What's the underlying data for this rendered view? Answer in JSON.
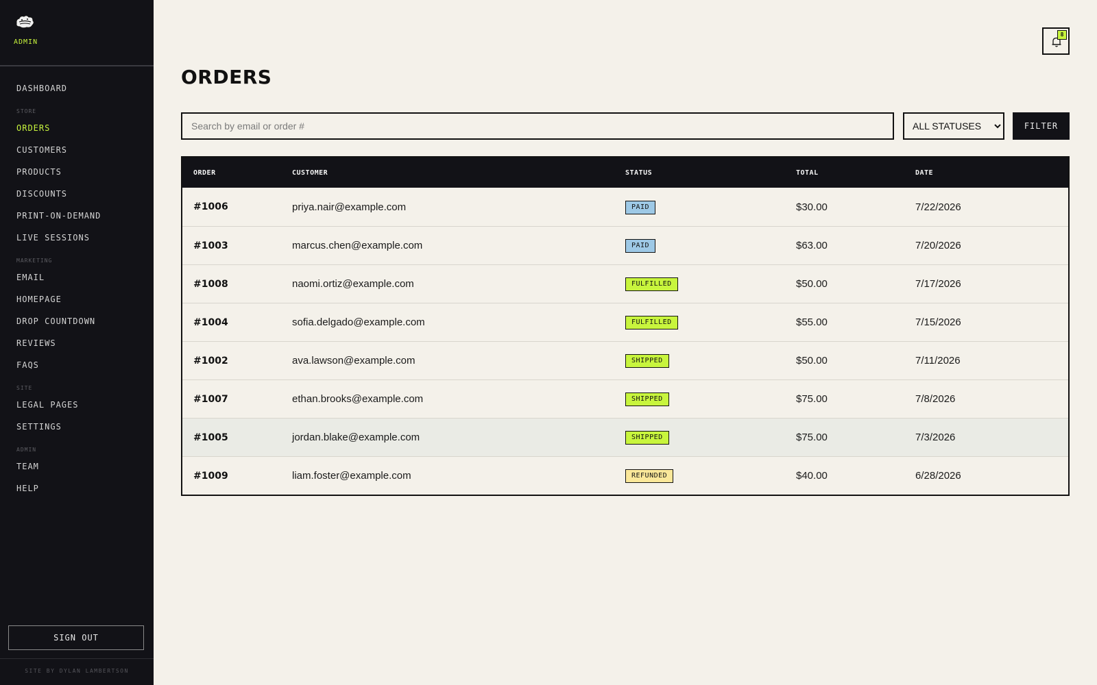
{
  "sidebar": {
    "brand_label": "ADMIN",
    "items": [
      {
        "type": "item",
        "label": "DASHBOARD"
      },
      {
        "type": "section",
        "label": "STORE"
      },
      {
        "type": "item",
        "label": "ORDERS",
        "active": true
      },
      {
        "type": "item",
        "label": "CUSTOMERS"
      },
      {
        "type": "item",
        "label": "PRODUCTS"
      },
      {
        "type": "item",
        "label": "DISCOUNTS"
      },
      {
        "type": "item",
        "label": "PRINT-ON-DEMAND"
      },
      {
        "type": "item",
        "label": "LIVE SESSIONS"
      },
      {
        "type": "section",
        "label": "MARKETING"
      },
      {
        "type": "item",
        "label": "EMAIL"
      },
      {
        "type": "item",
        "label": "HOMEPAGE"
      },
      {
        "type": "item",
        "label": "DROP COUNTDOWN"
      },
      {
        "type": "item",
        "label": "REVIEWS"
      },
      {
        "type": "item",
        "label": "FAQS"
      },
      {
        "type": "section",
        "label": "SITE"
      },
      {
        "type": "item",
        "label": "LEGAL PAGES"
      },
      {
        "type": "item",
        "label": "SETTINGS"
      },
      {
        "type": "section",
        "label": "ADMIN"
      },
      {
        "type": "item",
        "label": "TEAM"
      },
      {
        "type": "item",
        "label": "HELP"
      }
    ],
    "signout_label": "SIGN OUT",
    "footer": "SITE BY DYLAN LAMBERTSON"
  },
  "header": {
    "notification_count": "8",
    "notification_icon": "bell-icon"
  },
  "main": {
    "title": "ORDERS",
    "search_placeholder": "Search by email or order #",
    "search_value": "",
    "status_selected": "ALL STATUSES",
    "filter_label": "FILTER"
  },
  "table": {
    "headers": [
      "ORDER",
      "CUSTOMER",
      "STATUS",
      "TOTAL",
      "DATE"
    ],
    "rows": [
      {
        "order": "#1006",
        "customer": "priya.nair@example.com",
        "status": "PAID",
        "total": "$30.00",
        "date": "7/22/2026"
      },
      {
        "order": "#1003",
        "customer": "marcus.chen@example.com",
        "status": "PAID",
        "total": "$63.00",
        "date": "7/20/2026"
      },
      {
        "order": "#1008",
        "customer": "naomi.ortiz@example.com",
        "status": "FULFILLED",
        "total": "$50.00",
        "date": "7/17/2026"
      },
      {
        "order": "#1004",
        "customer": "sofia.delgado@example.com",
        "status": "FULFILLED",
        "total": "$55.00",
        "date": "7/15/2026"
      },
      {
        "order": "#1002",
        "customer": "ava.lawson@example.com",
        "status": "SHIPPED",
        "total": "$50.00",
        "date": "7/11/2026"
      },
      {
        "order": "#1007",
        "customer": "ethan.brooks@example.com",
        "status": "SHIPPED",
        "total": "$75.00",
        "date": "7/8/2026"
      },
      {
        "order": "#1005",
        "customer": "jordan.blake@example.com",
        "status": "SHIPPED",
        "total": "$75.00",
        "date": "7/3/2026",
        "hover": true
      },
      {
        "order": "#1009",
        "customer": "liam.foster@example.com",
        "status": "REFUNDED",
        "total": "$40.00",
        "date": "6/28/2026"
      }
    ]
  },
  "colors": {
    "accent": "#c8f53d",
    "sidebar_bg": "#121217",
    "page_bg": "#f4f1ea",
    "paid": "#9ec9e6",
    "refunded": "#fbe89a"
  }
}
